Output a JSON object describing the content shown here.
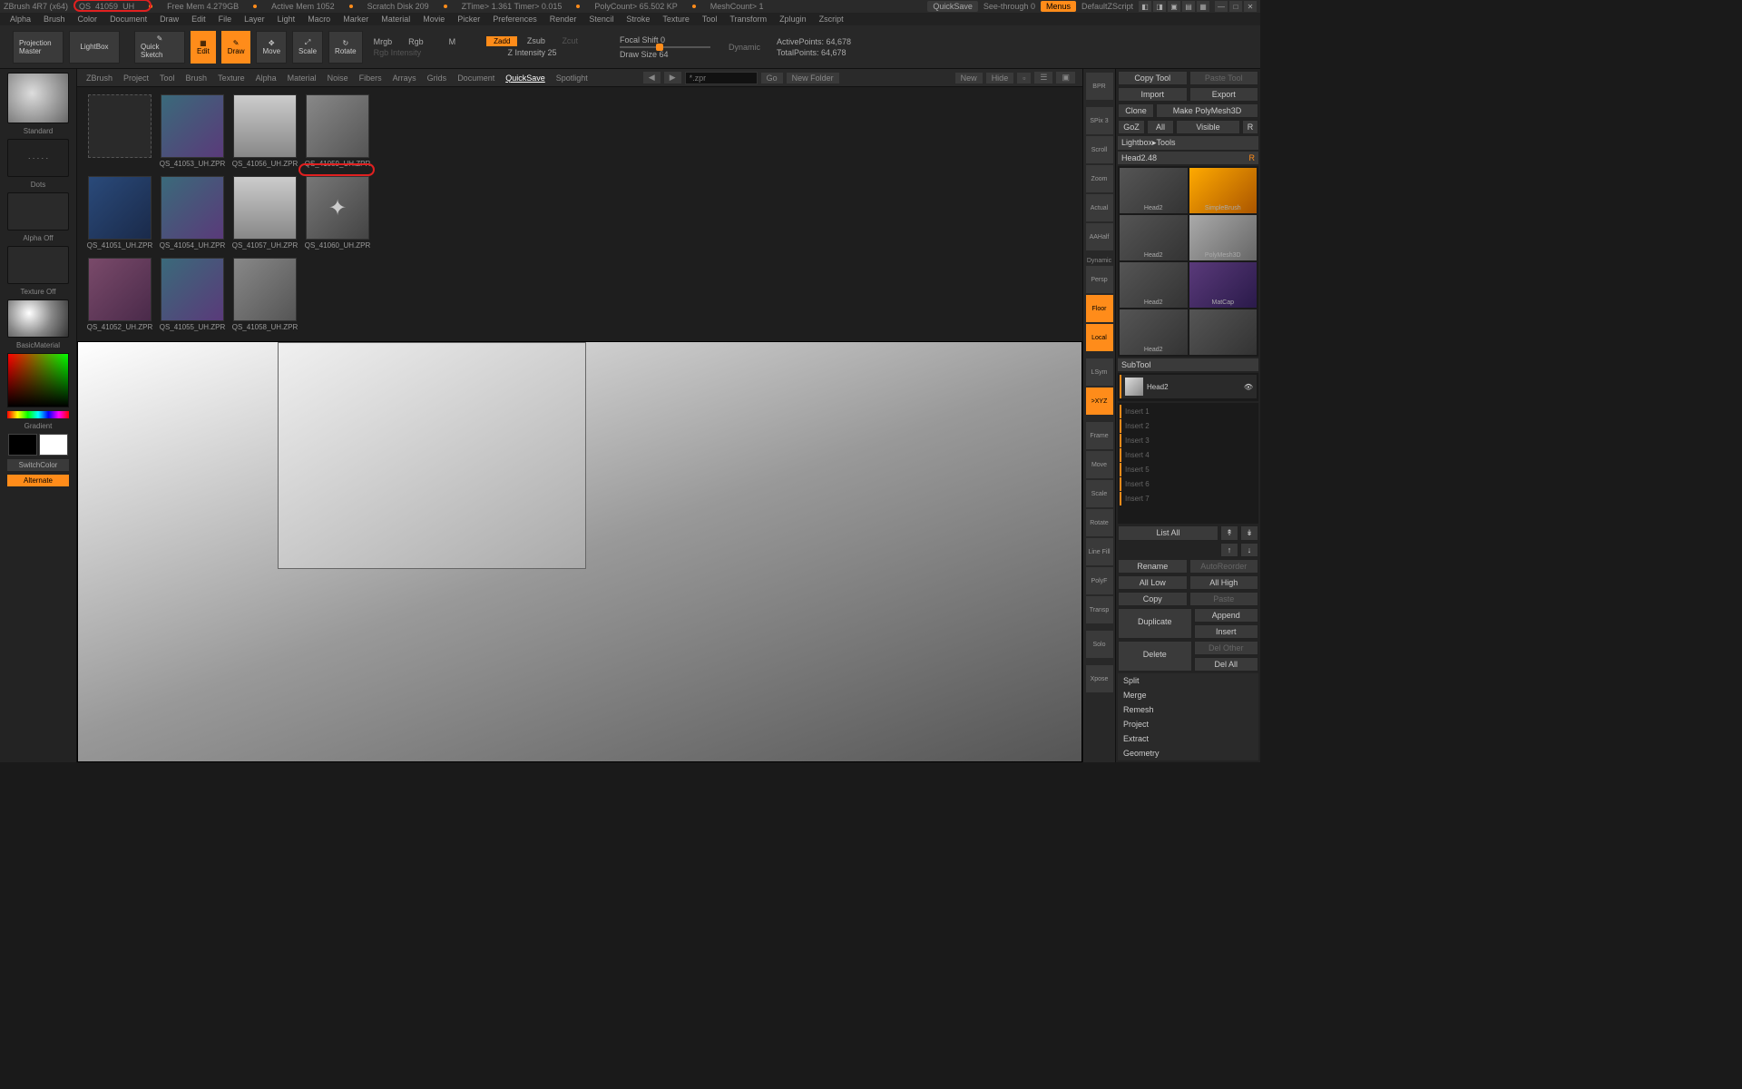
{
  "titlebar": {
    "app": "ZBrush 4R7 (x64)",
    "doc": "QS_41059_UH",
    "mem": "Free Mem 4.279GB",
    "active_mem": "Active Mem 1052",
    "scratch": "Scratch Disk 209",
    "ztime": "ZTime> 1.361 Timer> 0.015",
    "poly": "PolyCount> 65.502 KP",
    "mesh": "MeshCount> 1",
    "quicksave": "QuickSave",
    "seethrough": "See-through  0",
    "menus": "Menus",
    "zscript": "DefaultZScript"
  },
  "menubar": [
    "Alpha",
    "Brush",
    "Color",
    "Document",
    "Draw",
    "Edit",
    "File",
    "Layer",
    "Light",
    "Macro",
    "Marker",
    "Material",
    "Movie",
    "Picker",
    "Preferences",
    "Render",
    "Stencil",
    "Stroke",
    "Texture",
    "Tool",
    "Transform",
    "Zplugin",
    "Zscript"
  ],
  "toolbar": {
    "projection": "Projection Master",
    "lightbox": "LightBox",
    "quicksketch": "Quick Sketch",
    "edit": "Edit",
    "draw": "Draw",
    "move": "Move",
    "scale": "Scale",
    "rotate": "Rotate",
    "mrgb": "Mrgb",
    "rgb": "Rgb",
    "m": "M",
    "rgb_intensity": "Rgb Intensity",
    "zadd": "Zadd",
    "zsub": "Zsub",
    "zcut": "Zcut",
    "zintensity": "Z Intensity 25",
    "focal": "Focal Shift 0",
    "drawsize": "Draw Size 64",
    "dynamic": "Dynamic",
    "activepoints": "ActivePoints: 64,678",
    "totalpoints": "TotalPoints: 64,678"
  },
  "lightbox": {
    "tabs": [
      "ZBrush",
      "Project",
      "Tool",
      "Brush",
      "Texture",
      "Alpha",
      "Material",
      "Noise",
      "Fibers",
      "Arrays",
      "Grids",
      "Document",
      "QuickSave",
      "Spotlight"
    ],
    "active_tab": "QuickSave",
    "search_placeholder": "*.zpr",
    "go": "Go",
    "newfolder": "New Folder",
    "new": "New",
    "hide": "Hide",
    "items": [
      {
        "label": "",
        "cls": "folder"
      },
      {
        "label": "QS_41053_UH.ZPR",
        "cls": "t1"
      },
      {
        "label": "QS_41056_UH.ZPR",
        "cls": "t2"
      },
      {
        "label": "QS_41059_UH.ZPR",
        "cls": "t3",
        "circled": true
      },
      {
        "label": "QS_41051_UH.ZPR",
        "cls": "t4"
      },
      {
        "label": "QS_41054_UH.ZPR",
        "cls": "t1"
      },
      {
        "label": "QS_41057_UH.ZPR",
        "cls": "t2"
      },
      {
        "label": "QS_41060_UH.ZPR",
        "cls": "t6"
      },
      {
        "label": "QS_41052_UH.ZPR",
        "cls": "t5"
      },
      {
        "label": "QS_41055_UH.ZPR",
        "cls": "t1"
      },
      {
        "label": "QS_41058_UH.ZPR",
        "cls": "t3"
      }
    ]
  },
  "left": {
    "standard": "Standard",
    "dots": "Dots",
    "alpha_off": "Alpha Off",
    "texture_off": "Texture Off",
    "material": "BasicMaterial",
    "gradient": "Gradient",
    "switch": "SwitchColor",
    "alternate": "Alternate"
  },
  "right_tools": [
    "BPR",
    "",
    "SPix 3",
    "Scroll",
    "Zoom",
    "Actual",
    "AAHalf",
    "",
    "Persp",
    "Floor",
    "Local",
    "",
    "LSym",
    ">XYZ",
    "",
    "Frame",
    "Move",
    "Scale",
    "Rotate",
    "Line Fill",
    "PolyF",
    "Transp",
    "",
    "Solo",
    "",
    "Xpose"
  ],
  "right_tools_orange": [
    9,
    10,
    13
  ],
  "right_panel": {
    "copy_tool": "Copy Tool",
    "paste_tool": "Paste Tool",
    "import": "Import",
    "export": "Export",
    "clone": "Clone",
    "make_polymesh": "Make PolyMesh3D",
    "goz": "GoZ",
    "all": "All",
    "visible": "Visible",
    "r": "R",
    "lightbox_tools": "Lightbox▸Tools",
    "current_tool": "Head2.48",
    "tools": [
      "Head2",
      "SimpleBrush",
      "Head2",
      "PolyMesh3D",
      "Head2",
      "MatCap",
      "Head2",
      ""
    ],
    "subtool_header": "SubTool",
    "subtool_active": "Head2",
    "subtool_slots": [
      "Insert 1",
      "Insert 2",
      "Insert 3",
      "Insert 4",
      "Insert 5",
      "Insert 6",
      "Insert 7"
    ],
    "list_all": "List All",
    "rename": "Rename",
    "autoreorder": "AutoReorder",
    "all_low": "All Low",
    "all_high": "All High",
    "copy": "Copy",
    "paste": "Paste",
    "duplicate": "Duplicate",
    "append": "Append",
    "insert": "Insert",
    "delete": "Delete",
    "del_other": "Del Other",
    "del_all": "Del All",
    "sections": [
      "Split",
      "Merge",
      "Remesh",
      "Project",
      "Extract",
      "Geometry"
    ]
  }
}
